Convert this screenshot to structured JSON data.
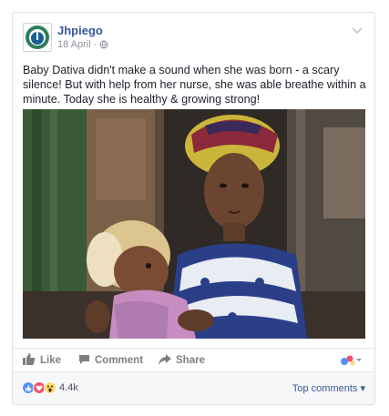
{
  "post": {
    "page_name": "Jhpiego",
    "date": "18 April",
    "separator": " · ",
    "privacy_icon": "globe-icon",
    "text": "Baby Dativa didn't make a sound when she was born - a scary silence! But with help from her nurse, she was able breathe within a minute. Today she is healthy & growing strong!",
    "photo_icon": "photo-mother-and-baby"
  },
  "actions": {
    "like_label": "Like",
    "comment_label": "Comment",
    "share_label": "Share"
  },
  "reactions": {
    "count": "4.4k",
    "types": [
      "like",
      "love",
      "wow"
    ],
    "top_comments_label": "Top comments ▾"
  },
  "colors": {
    "link": "#365899",
    "muted": "#90949c",
    "like_blue": "#5890ff",
    "love_red": "#f25268",
    "wow_yellow": "#ffda6a"
  }
}
